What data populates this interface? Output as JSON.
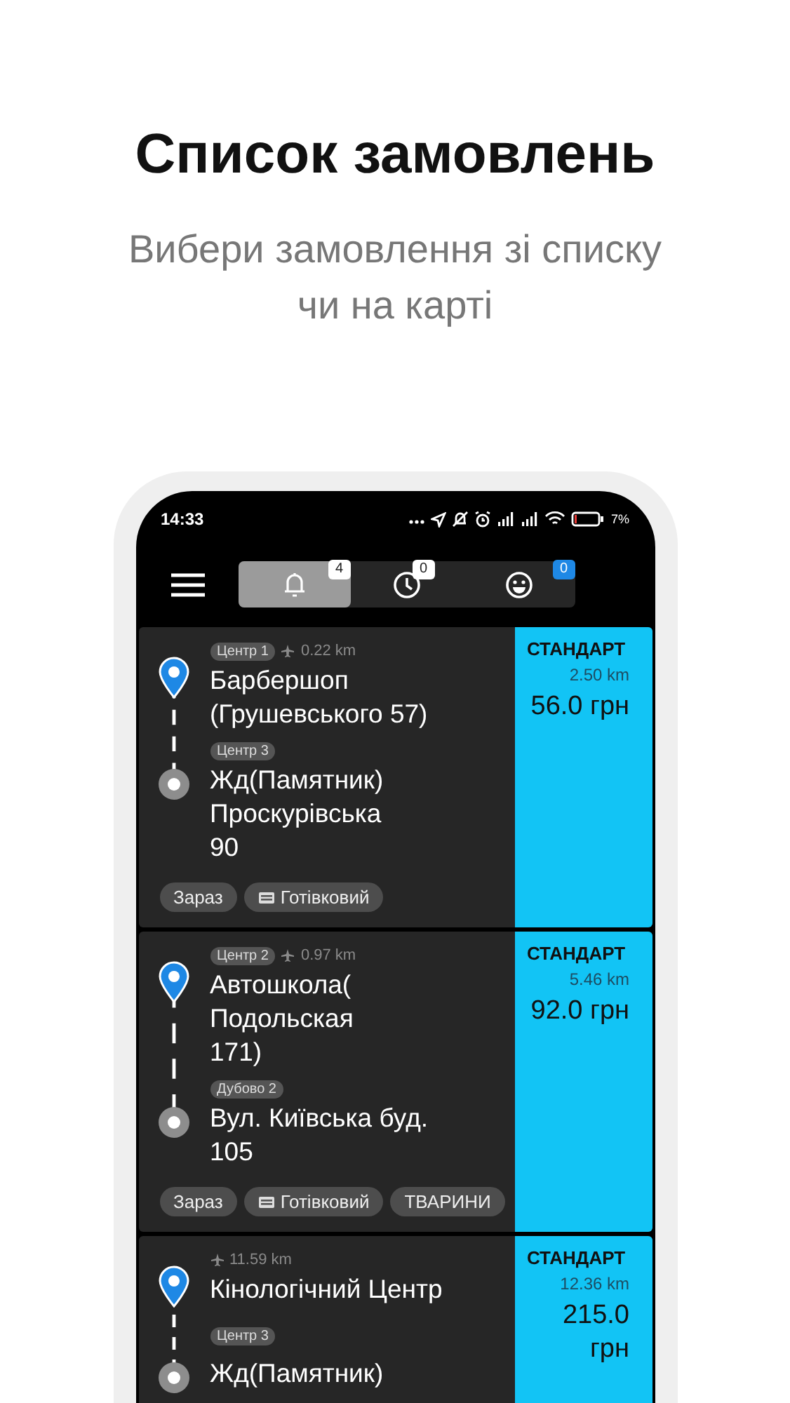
{
  "header": {
    "title": "Список замовлень",
    "subtitle": "Вибери замовлення зі списку чи на карті"
  },
  "status_bar": {
    "time": "14:33",
    "battery": "7%"
  },
  "tabs": [
    {
      "kind": "bell",
      "badge": "4",
      "color": "#ffffff",
      "selected": true
    },
    {
      "kind": "clock",
      "badge": "0",
      "color": "#ffffff",
      "selected": false
    },
    {
      "kind": "smiley",
      "badge": "0",
      "color": "#1e88e5",
      "selected": false
    }
  ],
  "orders": [
    {
      "pickup_zone": "Центр 1",
      "distance": "0.22 km",
      "pickup": "Барбершоп\n(Грушевського 57)",
      "dropoff_zone": "Центр 3",
      "dropoff": "Жд(Памятник)\nПроскурівська\n90",
      "tags": [
        {
          "kind": "time",
          "text": "Зараз"
        },
        {
          "kind": "payment",
          "text": "Готівковий"
        }
      ],
      "class": "СТАНДАРТ",
      "trip_distance": "2.50 km",
      "price": "56.0 грн"
    },
    {
      "pickup_zone": "Центр 2",
      "distance": "0.97 km",
      "pickup": "Автошкола(\nПодольская\n171)",
      "dropoff_zone": "Дубово 2",
      "dropoff": "Вул. Київська буд.\n105",
      "tags": [
        {
          "kind": "time",
          "text": "Зараз"
        },
        {
          "kind": "payment",
          "text": "Готівковий"
        },
        {
          "kind": "option",
          "text": "ТВАРИНИ"
        }
      ],
      "class": "СТАНДАРТ",
      "trip_distance": "5.46 km",
      "price": "92.0 грн"
    },
    {
      "distance": "11.59 km",
      "pickup": "Кінологічний Центр",
      "dropoff_zone": "Центр 3",
      "dropoff": "Жд(Памятник)",
      "class": "СТАНДАРТ",
      "trip_distance": "12.36 km",
      "price": "215.0 грн"
    }
  ]
}
